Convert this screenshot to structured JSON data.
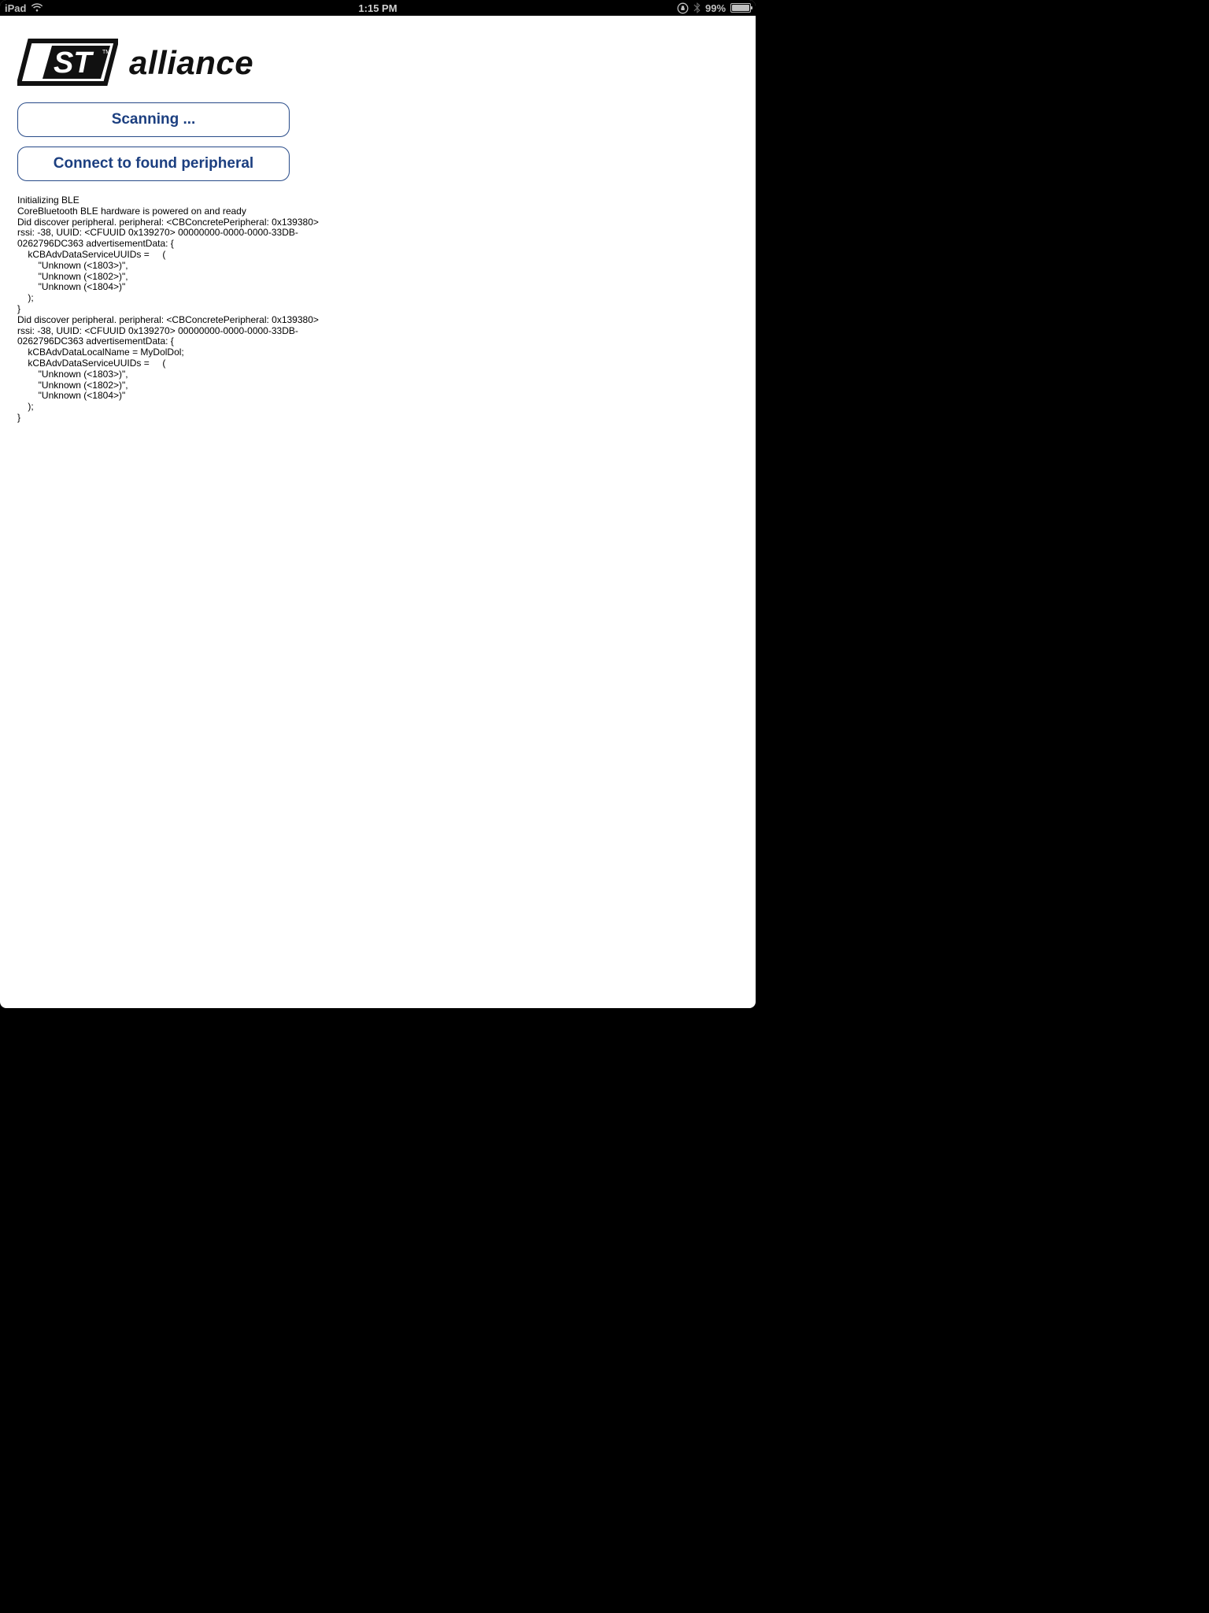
{
  "status": {
    "device": "iPad",
    "time": "1:15 PM",
    "battery_pct": "99",
    "battery_pct_suffix": "%"
  },
  "logo": {
    "brand_word": "alliance"
  },
  "buttons": {
    "scan_label": "Scanning ...",
    "connect_label": "Connect to found peripheral"
  },
  "log_text": "Initializing BLE\nCoreBluetooth BLE hardware is powered on and ready\nDid discover peripheral. peripheral: <CBConcretePeripheral: 0x139380>\nrssi: -38, UUID: <CFUUID 0x139270> 00000000-0000-0000-33DB-\n0262796DC363 advertisementData: {\n    kCBAdvDataServiceUUIDs =     (\n        \"Unknown (<1803>)\",\n        \"Unknown (<1802>)\",\n        \"Unknown (<1804>)\"\n    );\n}\nDid discover peripheral. peripheral: <CBConcretePeripheral: 0x139380>\nrssi: -38, UUID: <CFUUID 0x139270> 00000000-0000-0000-33DB-\n0262796DC363 advertisementData: {\n    kCBAdvDataLocalName = MyDolDol;\n    kCBAdvDataServiceUUIDs =     (\n        \"Unknown (<1803>)\",\n        \"Unknown (<1802>)\",\n        \"Unknown (<1804>)\"\n    );\n}"
}
